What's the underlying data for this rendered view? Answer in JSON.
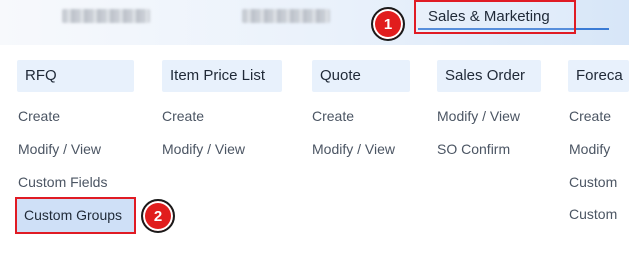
{
  "topbar": {
    "active_tab": "Sales & Marketing"
  },
  "callouts": [
    "1",
    "2"
  ],
  "menu": {
    "columns": [
      {
        "header": "RFQ",
        "items": [
          "Create",
          "Modify / View",
          "Custom Fields",
          "Custom Groups"
        ]
      },
      {
        "header": "Item Price List",
        "items": [
          "Create",
          "Modify / View"
        ]
      },
      {
        "header": "Quote",
        "items": [
          "Create",
          "Modify / View"
        ]
      },
      {
        "header": "Sales Order",
        "items": [
          "Modify / View",
          "SO Confirm"
        ]
      },
      {
        "header": "Foreca",
        "items": [
          "Create",
          "Modify",
          "Custom",
          "Custom"
        ]
      }
    ]
  },
  "colors": {
    "highlight_border": "#e01b24",
    "highlight_fill": "#cfe0f7",
    "underline": "#3a7bd5"
  }
}
